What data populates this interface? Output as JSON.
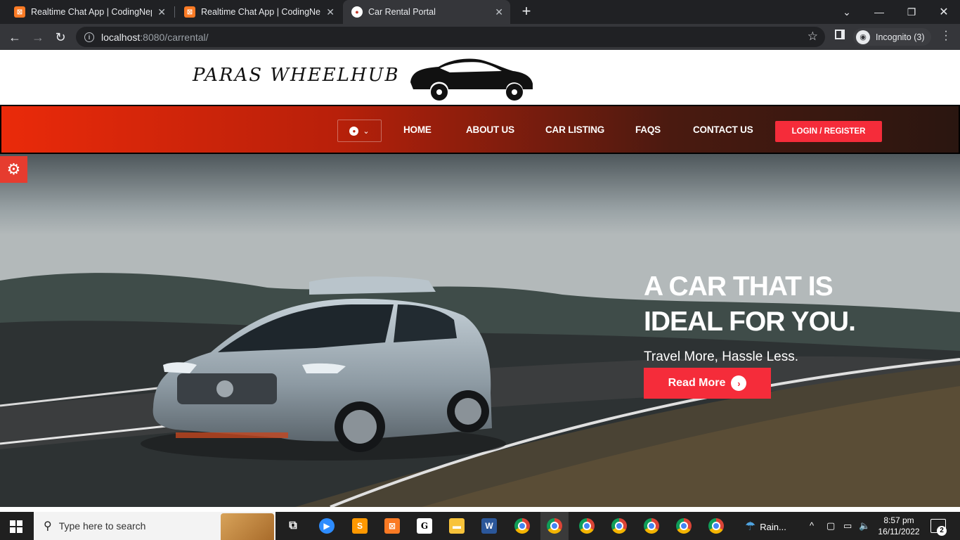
{
  "browser": {
    "tabs": [
      {
        "title": "Realtime Chat App | CodingNepal",
        "favicon": "xampp-icon"
      },
      {
        "title": "Realtime Chat App | CodingNepal",
        "favicon": "xampp-icon"
      },
      {
        "title": "Car Rental Portal",
        "favicon": "car-icon"
      }
    ],
    "address": {
      "host": "localhost",
      "path": ":8080/carrental/"
    },
    "incognito_label": "Incognito (3)"
  },
  "site": {
    "logo_text": "PARAS WHEELHUB",
    "nav": {
      "items": [
        "HOME",
        "ABOUT US",
        "CAR LISTING",
        "FAQS",
        "CONTACT US"
      ],
      "login_label": "LOGIN / REGISTER"
    },
    "hero": {
      "title_line1": "A CAR THAT IS",
      "title_line2": "IDEAL FOR YOU.",
      "subtitle": "Travel More, Hassle Less.",
      "button_label": "Read More"
    },
    "colors": {
      "accent": "#f52c3a",
      "navbar_start": "#ea2a0a",
      "navbar_end": "#2a1610"
    }
  },
  "taskbar": {
    "search_placeholder": "Type here to search",
    "weather": "Rain...",
    "time": "8:57 pm",
    "date": "16/11/2022",
    "notification_count": "2"
  }
}
